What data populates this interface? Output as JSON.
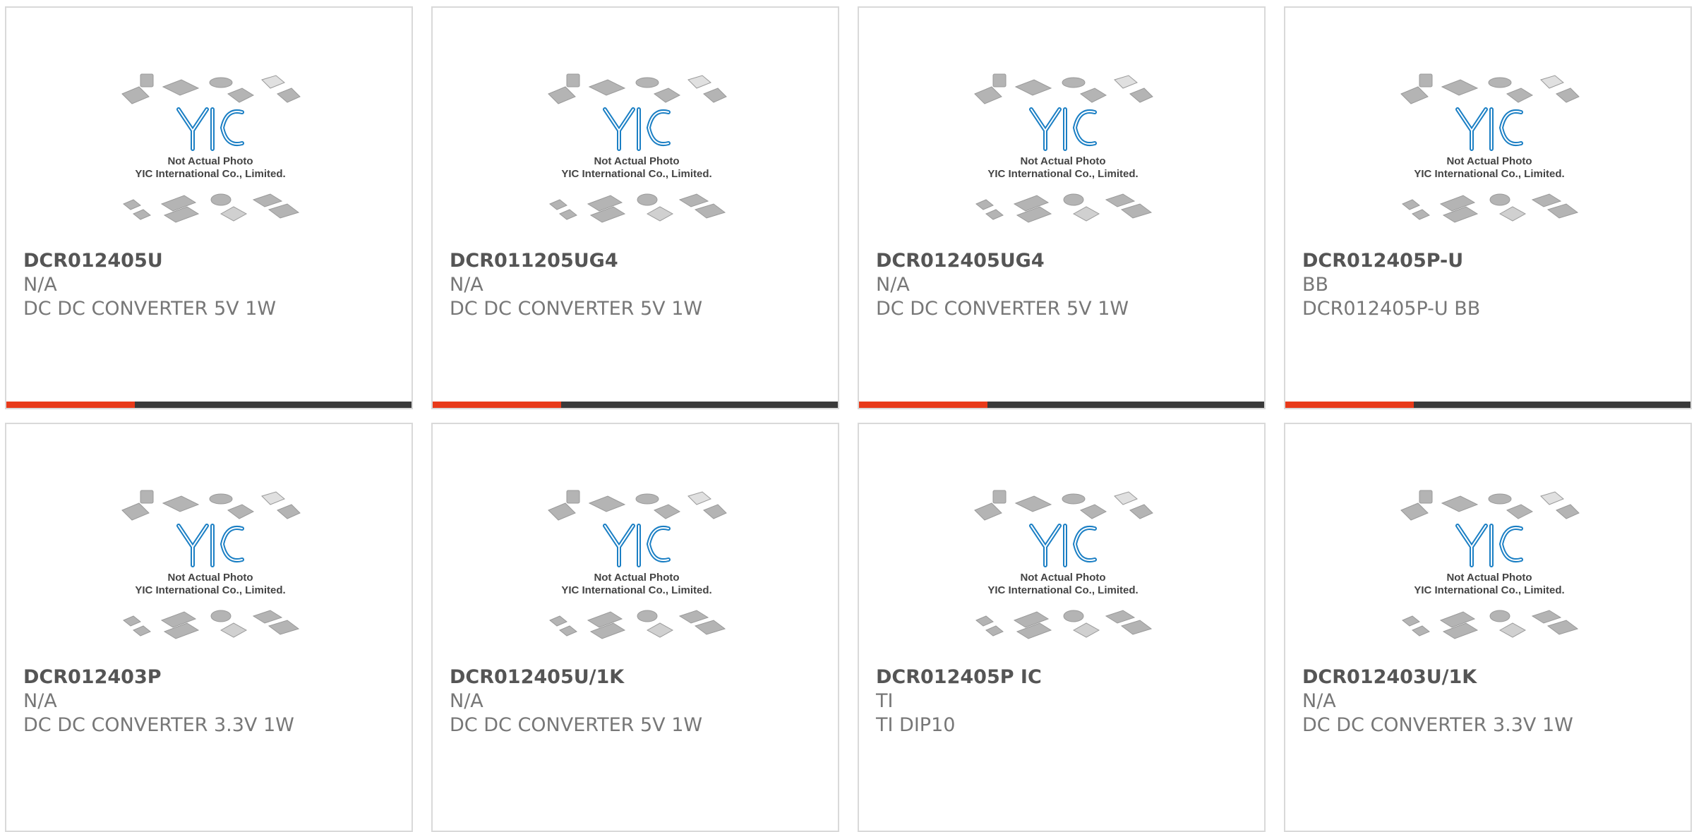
{
  "colors": {
    "accent": "#e83a1a",
    "bar": "#3a3a3a",
    "logo": "#1b7fc4",
    "border": "#d9d9d9",
    "title_text": "#555555",
    "body_text": "#777777"
  },
  "placeholder": {
    "logo_text": "YIC",
    "line1": "Not Actual Photo",
    "line2": "YIC International Co., Limited."
  },
  "products": [
    {
      "part_number": "DCR012405U",
      "manufacturer": "N/A",
      "description": "DC DC CONVERTER 5V 1W"
    },
    {
      "part_number": "DCR011205UG4",
      "manufacturer": "N/A",
      "description": "DC DC CONVERTER 5V 1W"
    },
    {
      "part_number": "DCR012405UG4",
      "manufacturer": "N/A",
      "description": "DC DC CONVERTER 5V 1W"
    },
    {
      "part_number": "DCR012405P-U",
      "manufacturer": "BB",
      "description": "DCR012405P-U BB"
    },
    {
      "part_number": "DCR012403P",
      "manufacturer": "N/A",
      "description": "DC DC CONVERTER 3.3V 1W"
    },
    {
      "part_number": "DCR012405U/1K",
      "manufacturer": "N/A",
      "description": "DC DC CONVERTER 5V 1W"
    },
    {
      "part_number": "DCR012405P IC",
      "manufacturer": "TI",
      "description": "TI DIP10"
    },
    {
      "part_number": "DCR012403U/1K",
      "manufacturer": "N/A",
      "description": "DC DC CONVERTER 3.3V 1W"
    }
  ]
}
